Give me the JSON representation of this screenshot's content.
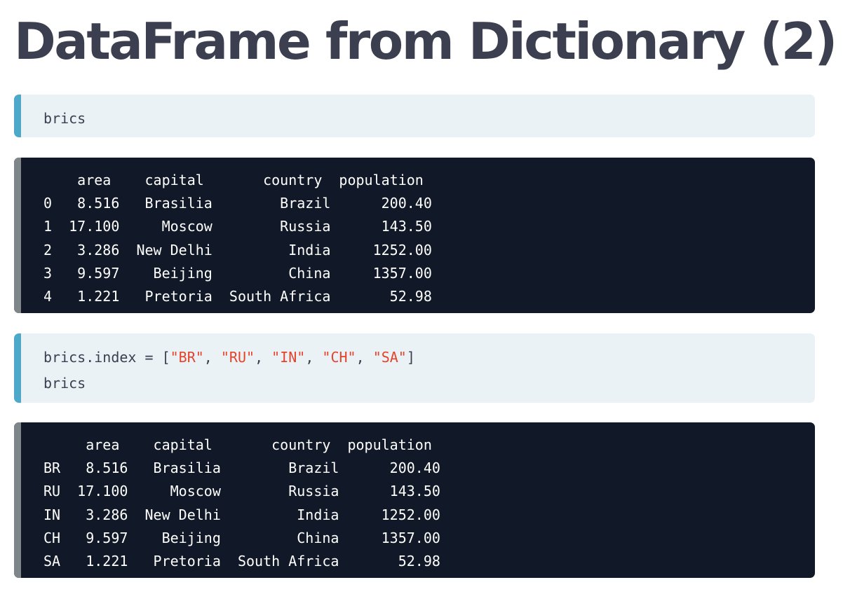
{
  "title": "DataFrame from Dictionary (2)",
  "blocks": [
    {
      "kind": "input",
      "lines": [
        [
          {
            "t": "brics"
          }
        ]
      ]
    },
    {
      "kind": "output",
      "text": "    area    capital       country  population\n0   8.516   Brasilia        Brazil      200.40\n1  17.100     Moscow        Russia      143.50\n2   3.286  New Delhi         India     1252.00\n3   9.597    Beijing         China     1357.00\n4   1.221   Pretoria  South Africa       52.98"
    },
    {
      "kind": "input",
      "lines": [
        [
          {
            "t": "brics.index = ["
          },
          {
            "t": "\"BR\"",
            "s": true
          },
          {
            "t": ", "
          },
          {
            "t": "\"RU\"",
            "s": true
          },
          {
            "t": ", "
          },
          {
            "t": "\"IN\"",
            "s": true
          },
          {
            "t": ", "
          },
          {
            "t": "\"CH\"",
            "s": true
          },
          {
            "t": ", "
          },
          {
            "t": "\"SA\"",
            "s": true
          },
          {
            "t": "]"
          }
        ],
        [
          {
            "t": "brics"
          }
        ]
      ]
    },
    {
      "kind": "output",
      "text": "     area    capital       country  population\nBR   8.516   Brasilia        Brazil      200.40\nRU  17.100     Moscow        Russia      143.50\nIN   3.286  New Delhi         India     1252.00\nCH   9.597    Beijing         China     1357.00\nSA   1.221   Pretoria  South Africa       52.98"
    }
  ],
  "colors": {
    "title": "#3b3f4f",
    "input_bg": "#ebf2f6",
    "input_bar": "#4ea8c9",
    "output_bg": "#111827",
    "output_bar": "#7f868a",
    "string": "#e5422a"
  }
}
